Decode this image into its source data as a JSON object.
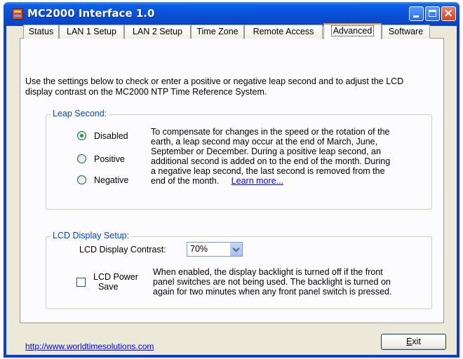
{
  "window": {
    "title": "MC2000 Interface 1.0"
  },
  "tabs": [
    "Status",
    "LAN 1 Setup",
    "LAN 2 Setup",
    "Time Zone",
    "Remote Access",
    "Advanced",
    "Software"
  ],
  "active_tab": "Advanced",
  "intro": "Use the settings below to check or enter a positive or negative leap second and to adjust the LCD display contrast on the MC2000 NTP Time Reference System.",
  "leap_second": {
    "title": "Leap Second:",
    "options": [
      "Disabled",
      "Positive",
      "Negative"
    ],
    "selected": "Disabled",
    "description": [
      "To compensate for changes in the speed or the rotation of the",
      "earth, a leap second may occur at the end of March, June,",
      "September or December.  During a positive leap second, an",
      "additional second is added on to the end of the month.  During",
      "a negative leap second, the last second is removed from the",
      "end of the month."
    ],
    "learn_more": "Learn more..."
  },
  "lcd": {
    "title": "LCD Display Setup:",
    "contrast_label": "LCD Display Contrast:",
    "contrast_value": "70%",
    "power_save_label_1": "LCD Power",
    "power_save_label_2": "Save",
    "power_save_checked": false,
    "description": [
      "When enabled, the display backlight is turned off if the front",
      "panel switches are not being used.  The backlight is turned on",
      "again for two minutes when any front panel switch is pressed."
    ]
  },
  "footer": {
    "link": "http://www.worldtimesolutions.com",
    "exit_prefix": "E",
    "exit_rest": "xit"
  },
  "colors": {
    "title_bar": "#0a4ed6",
    "group_title": "#0046d5",
    "active_tab_accent": "#e68b2c",
    "link": "#0000ff"
  }
}
